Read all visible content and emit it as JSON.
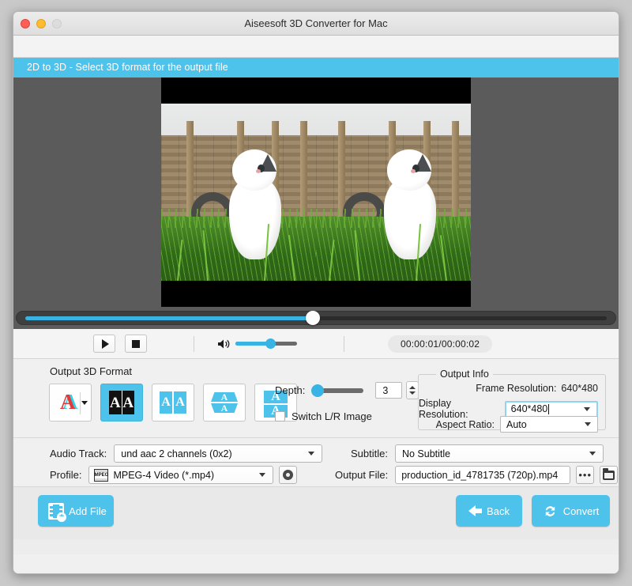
{
  "window": {
    "title": "Aiseesoft 3D Converter for Mac",
    "traffic_lights": [
      "close-red",
      "minimize-yellow",
      "zoom-grey"
    ]
  },
  "banner": {
    "text": "2D to 3D - Select 3D format for the output file"
  },
  "preview": {
    "mode": "side-by-side-stereo",
    "description": "White and grey kitten sitting in green grass in front of a wooden fence"
  },
  "seek": {
    "position_percent": 50,
    "value": "00:00:01"
  },
  "transport": {
    "play_icon": "play-icon",
    "stop_icon": "stop-icon",
    "volume_icon": "speaker-icon",
    "volume_percent": 56,
    "timecode": "00:00:01/00:00:02"
  },
  "format_section": {
    "title": "Output 3D Format",
    "buttons": [
      {
        "name": "anaglyph",
        "icon": "anaglyph-A-icon",
        "selected": false,
        "has_dropdown": true
      },
      {
        "name": "interlaced",
        "icon": "interlaced-AA-icon",
        "selected": true,
        "has_dropdown": false
      },
      {
        "name": "side-by-side",
        "icon": "side-by-side-AA-icon",
        "selected": false,
        "has_dropdown": false
      },
      {
        "name": "anamorphic-top-bottom",
        "icon": "anamorphic-top-bottom-icon",
        "selected": false,
        "has_dropdown": false
      },
      {
        "name": "top-bottom",
        "icon": "top-bottom-A-icon",
        "selected": false,
        "has_dropdown": false
      }
    ],
    "depth_label": "Depth:",
    "depth_value": "3",
    "depth_percent": 4,
    "switch_lr_label": "Switch L/R Image",
    "switch_lr_checked": false
  },
  "output_info": {
    "title": "Output Info",
    "frame_resolution_label": "Frame Resolution:",
    "frame_resolution_value": "640*480",
    "display_resolution_label": "Display Resolution:",
    "display_resolution_value": "640*480",
    "aspect_ratio_label": "Aspect Ratio:",
    "aspect_ratio_value": "Auto"
  },
  "settings": {
    "audio_track_label": "Audio Track:",
    "audio_track_value": "und aac 2 channels (0x2)",
    "profile_label": "Profile:",
    "profile_value": "MPEG-4 Video (*.mp4)",
    "profile_icon_text": "MPEG",
    "subtitle_label": "Subtitle:",
    "subtitle_value": "No Subtitle",
    "output_file_label": "Output File:",
    "output_file_value": "production_id_4781735 (720p).mp4",
    "settings_gear_icon": "gear-icon",
    "browse_dots_label": "•••",
    "folder_icon": "folder-icon"
  },
  "actions": {
    "add_file_label": "Add File",
    "add_file_icon": "film-strip-add-icon",
    "back_label": "Back",
    "back_icon": "arrow-left-icon",
    "convert_label": "Convert",
    "convert_icon": "sync-arrows-icon"
  },
  "colors": {
    "accent": "#4dc3ec",
    "banner": "#4dc3ec",
    "slider_fill": "#38b3e3",
    "window_bg": "#f0f0f0",
    "preview_bg": "#5b5b5b"
  }
}
